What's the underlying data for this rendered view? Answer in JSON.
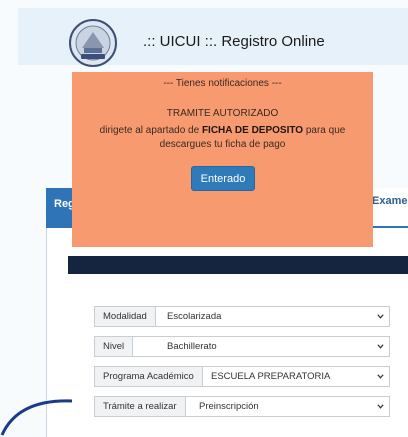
{
  "header": {
    "title": ".:: UICUI ::. Registro Online",
    "logo_icon": "university-seal-logo"
  },
  "tabs": {
    "left_label": "Registro",
    "right_label": "Exame"
  },
  "notification": {
    "title": "--- Tienes notificaciones ---",
    "status": "TRAMITE AUTORIZADO",
    "message_prefix": "dirigete al apartado de ",
    "message_bold": "FICHA DE DEPOSITO",
    "message_suffix": " para que",
    "message_line3": "descargues tu ficha de pago",
    "button_label": "Enterado"
  },
  "form": {
    "modalidad": {
      "label": "Modalidad",
      "value": "Escolarizada"
    },
    "nivel": {
      "label": "Nivel",
      "value": "Bachillerato"
    },
    "programa": {
      "label": "Programa Académico",
      "value": "ESCUELA PREPARATORIA"
    },
    "tramite": {
      "label": "Trámite a realizar",
      "value": "Preinscripción"
    }
  },
  "colors": {
    "notice_bg": "#f79a70",
    "button_bg": "#2f7ab8",
    "header_bg": "#e6f1f9",
    "dark_bar": "#15253f"
  }
}
